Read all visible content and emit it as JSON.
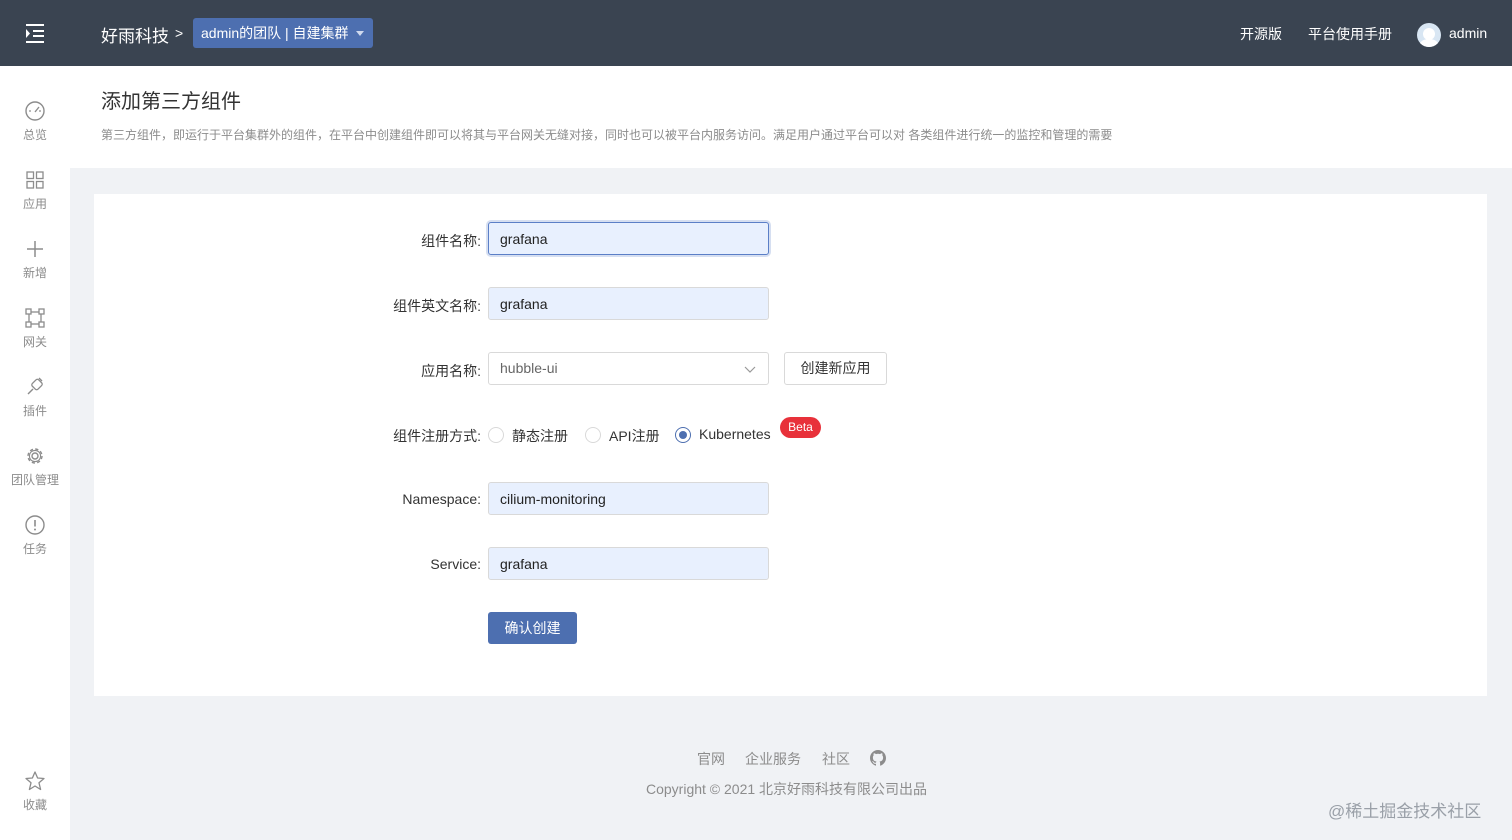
{
  "header": {
    "brand": "好雨科技",
    "breadcrumb_separator": ">",
    "team_selector": "admin的团队 | 自建集群",
    "links": {
      "open_source": "开源版",
      "manual": "平台使用手册"
    },
    "user": "admin",
    "colors": {
      "background": "#3a4451",
      "accent": "#4d6fb0"
    }
  },
  "sidebar": {
    "items": [
      {
        "icon": "dashboard-icon",
        "label": "总览"
      },
      {
        "icon": "apps-grid-icon",
        "label": "应用"
      },
      {
        "icon": "plus-icon",
        "label": "新增"
      },
      {
        "icon": "gateway-icon",
        "label": "网关"
      },
      {
        "icon": "plugin-icon",
        "label": "插件"
      },
      {
        "icon": "gear-icon",
        "label": "团队管理"
      },
      {
        "icon": "exclamation-circle-icon",
        "label": "任务"
      },
      {
        "icon": "star-icon",
        "label": "收藏"
      }
    ]
  },
  "page": {
    "title": "添加第三方组件",
    "description": "第三方组件，即运行于平台集群外的组件，在平台中创建组件即可以将其与平台网关无缝对接，同时也可以被平台内服务访问。满足用户通过平台可以对 各类组件进行统一的监控和管理的需要"
  },
  "form": {
    "component_name": {
      "label": "组件名称:",
      "value": "grafana"
    },
    "component_en_name": {
      "label": "组件英文名称:",
      "value": "grafana"
    },
    "app_name": {
      "label": "应用名称:",
      "selected": "hubble-ui",
      "create_button": "创建新应用"
    },
    "registration": {
      "label": "组件注册方式:",
      "options": [
        "静态注册",
        "API注册",
        "Kubernetes"
      ],
      "selected": "Kubernetes",
      "badge": "Beta"
    },
    "namespace": {
      "label": "Namespace:",
      "value": "cilium-monitoring"
    },
    "service": {
      "label": "Service:",
      "value": "grafana"
    },
    "submit": "确认创建"
  },
  "footer": {
    "links": [
      "官网",
      "企业服务",
      "社区"
    ],
    "github_icon": "github-icon",
    "copyright": "Copyright © 2021 北京好雨科技有限公司出品"
  },
  "watermark": "@稀土掘金技术社区"
}
